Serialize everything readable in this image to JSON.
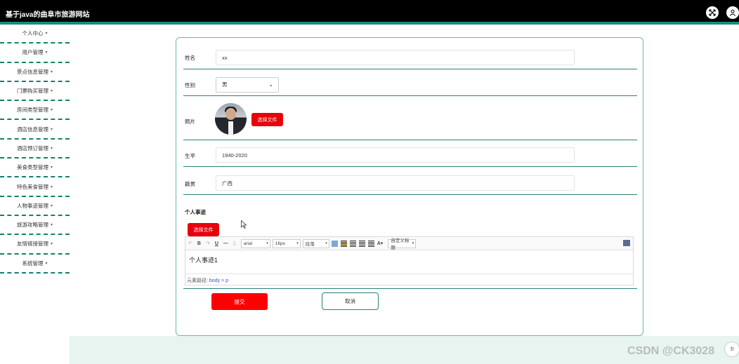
{
  "header": {
    "title": "基于java的曲阜市旅游网站"
  },
  "icons": {
    "fullscreen": "fullscreen-icon",
    "user": "user-icon"
  },
  "colors": {
    "topbar": "#000000",
    "accent": "#1a8a80",
    "primary_button": "#ff0000"
  },
  "sidebar": {
    "items": [
      {
        "label": "个人中心"
      },
      {
        "label": "用户管理"
      },
      {
        "label": "景点信息管理"
      },
      {
        "label": "门票购买管理"
      },
      {
        "label": "房间类型管理"
      },
      {
        "label": "酒店信息管理"
      },
      {
        "label": "酒店预订管理"
      },
      {
        "label": "美食类型管理"
      },
      {
        "label": "特色美食管理"
      },
      {
        "label": "人物事迹管理"
      },
      {
        "label": "旅游攻略管理"
      },
      {
        "label": "友情链接管理"
      },
      {
        "label": "系统管理"
      }
    ]
  },
  "form": {
    "name": {
      "label": "姓名",
      "value": "xx"
    },
    "gender": {
      "label": "性别",
      "value": "男"
    },
    "photo": {
      "label": "照片",
      "button": "选择文件"
    },
    "lifespan": {
      "label": "生平",
      "value": "1940-2020"
    },
    "origin": {
      "label": "籍贯",
      "value": "广西"
    },
    "deeds": {
      "label": "个人事迹",
      "button": "选择文件",
      "toolbar": {
        "font": "arial",
        "size": "16px",
        "paragraph": "段落",
        "custom_heading": "自定义标题",
        "font_color": "A"
      },
      "content": "个人事迹1",
      "footer_label": "元素路径:",
      "footer_path": "body > p"
    },
    "submit": "提交",
    "cancel": "取消"
  },
  "watermark": "CSDN @CK3028"
}
